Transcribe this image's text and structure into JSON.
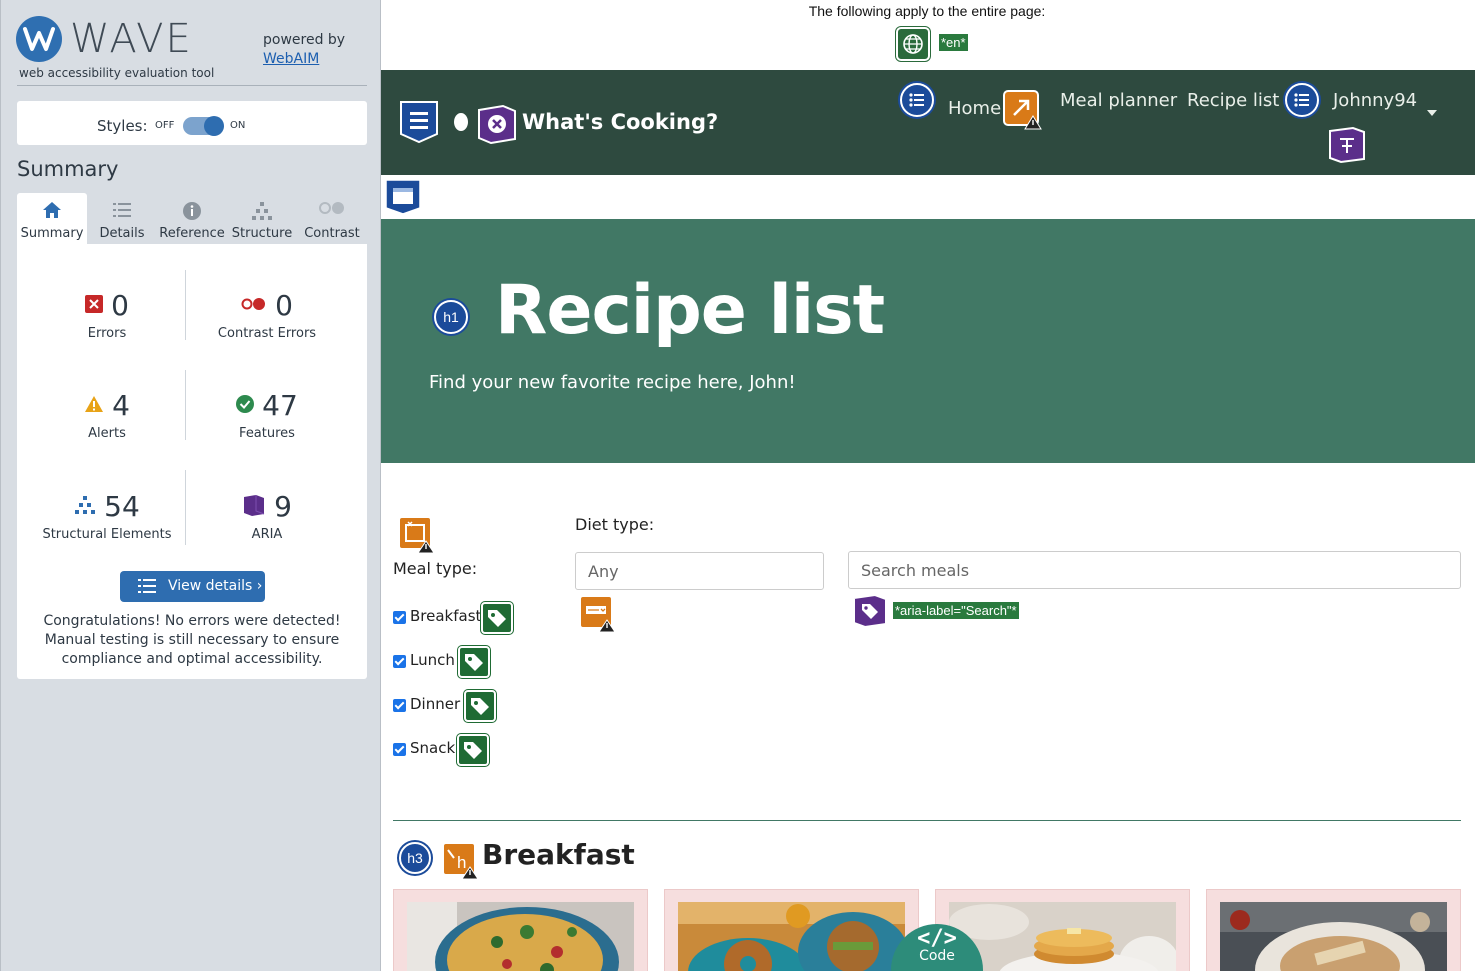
{
  "wave": {
    "title": "WAVE",
    "subtitle": "web accessibility evaluation tool",
    "powered_by": "powered by",
    "webaim": "WebAIM",
    "styles_label": "Styles:",
    "styles_off": "OFF",
    "styles_on": "ON",
    "summary_heading": "Summary",
    "tabs": [
      {
        "label": "Summary",
        "icon": "home-icon",
        "active": true
      },
      {
        "label": "Details",
        "icon": "list-icon",
        "active": false
      },
      {
        "label": "Reference",
        "icon": "info-icon",
        "active": false
      },
      {
        "label": "Structure",
        "icon": "hierarchy-icon",
        "active": false
      },
      {
        "label": "Contrast",
        "icon": "contrast-icon",
        "active": false
      }
    ],
    "stats": {
      "errors": {
        "value": "0",
        "label": "Errors"
      },
      "contrast_errors": {
        "value": "0",
        "label": "Contrast Errors"
      },
      "alerts": {
        "value": "4",
        "label": "Alerts"
      },
      "features": {
        "value": "47",
        "label": "Features"
      },
      "structural": {
        "value": "54",
        "label": "Structural Elements"
      },
      "aria": {
        "value": "9",
        "label": "ARIA"
      }
    },
    "view_details": "View details ›",
    "congrats": "Congratulations! No errors were detected! Manual testing is still necessary to ensure compliance and optimal accessibility."
  },
  "page": {
    "applies_text": "The following apply to the entire page:",
    "lang_tag": "*en*",
    "brand": "What's Cooking?",
    "nav": {
      "home": "Home",
      "meal_planner": "Meal planner",
      "recipe_list": "Recipe list",
      "user": "Johnny94"
    },
    "hero": {
      "title": "Recipe list",
      "subtitle": "Find your new favorite recipe here, John!"
    },
    "filters": {
      "meal_type_label": "Meal type:",
      "meal_types": [
        "Breakfast",
        "Lunch",
        "Dinner",
        "Snack"
      ],
      "diet_type_label": "Diet type:",
      "diet_value": "Any",
      "search_placeholder": "Search meals",
      "aria_tag": "*aria-label=\"Search\"*"
    },
    "section_heading": "Breakfast",
    "heading_badges": {
      "h1": "h1",
      "h3": "h3",
      "h_alert": "h"
    },
    "code_button": {
      "glyph": "</>",
      "label": "Code"
    }
  },
  "colors": {
    "wave_bg": "#d8dde3",
    "wave_blue": "#2e6db0",
    "navbar": "#2e4a3f",
    "hero": "#417865",
    "feature_green": "#1f6b34",
    "alert_orange": "#d97a18",
    "aria_purple": "#5b2e8a",
    "error_red": "#c62828"
  }
}
